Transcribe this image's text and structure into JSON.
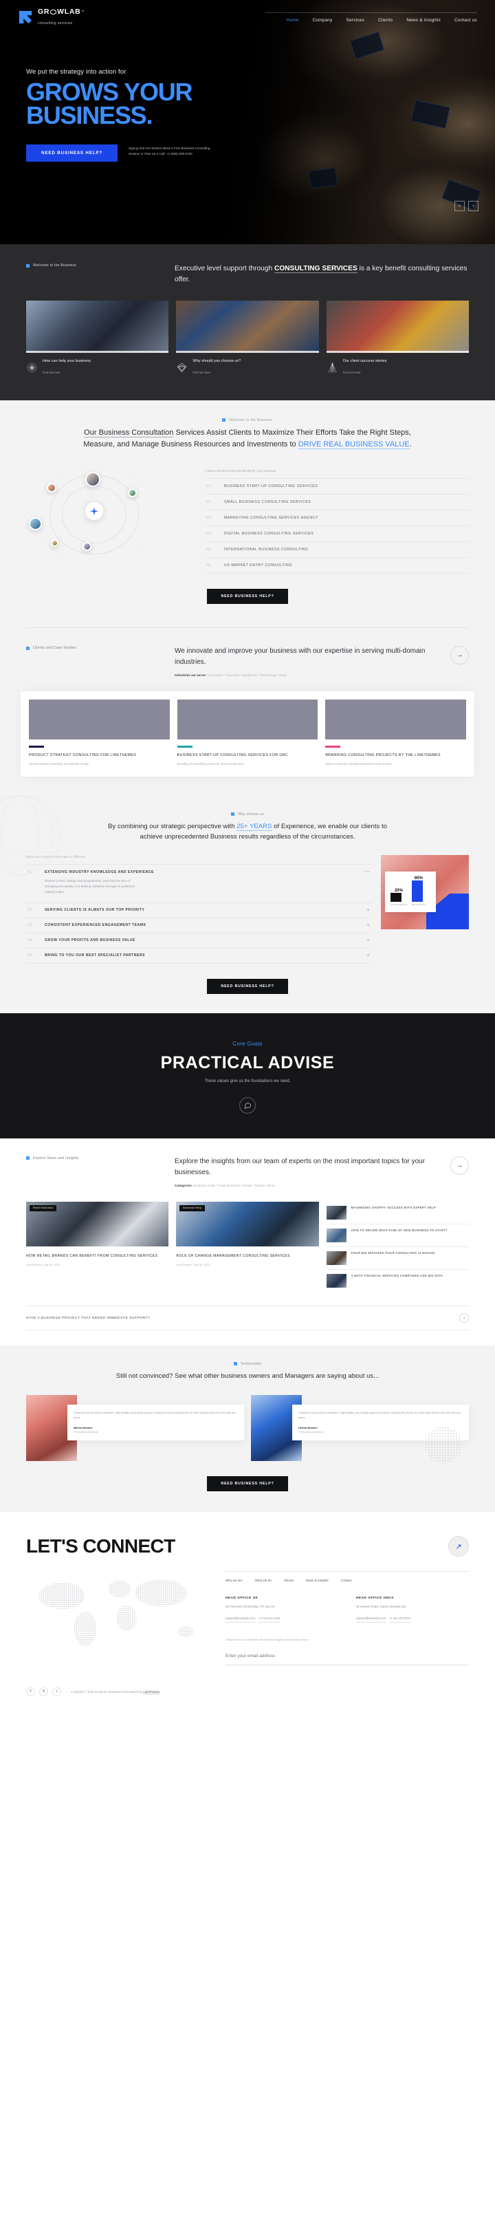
{
  "brand": {
    "name_pre": "GR",
    "name_post": "WLAB",
    "tm": "™",
    "tagline": "consulting services"
  },
  "nav": {
    "items": [
      {
        "label": "Home",
        "active": true
      },
      {
        "label": "Company",
        "active": false
      },
      {
        "label": "Services",
        "active": false
      },
      {
        "label": "Clients",
        "active": false
      },
      {
        "label": "News & Insights",
        "active": false
      },
      {
        "label": "Contact us",
        "active": false
      }
    ]
  },
  "hero": {
    "kicker": "We put the strategy into action for",
    "title_line1": "GROWS YOUR",
    "title_line2": "BUSINESS.",
    "cta": "NEED BUSINESS HELP?",
    "note": "Signup and Get Started about a Free Business Consulting Session or Give Us a Call: +1 (695) 605-0190",
    "prev": "‹",
    "next": "›"
  },
  "welcome": {
    "tag": "Welcome to the Business",
    "head_pre": "Executive level support through ",
    "head_bold": "CONSULTING SERVICES",
    "head_post": " is a key benefit consulting services offer.",
    "cards": [
      {
        "title": "How can help your business",
        "sub": "Find out more",
        "icon": "sunburst-icon"
      },
      {
        "title": "Why should you choose us?",
        "sub": "Find out more",
        "icon": "diamond-icon"
      },
      {
        "title": "Our client success stories",
        "sub": "Find out more",
        "icon": "tower-icon"
      }
    ]
  },
  "consult": {
    "tag": "Welcome to the Business",
    "head_1": "Our Business Consultation",
    "head_2": " Services Assist Clients to Maximize Their Efforts Take the Right Steps, Measure, and Manage Business Resources and Investments to ",
    "head_3": "DRIVE REAL BUSINESS VALUE",
    "head_4": ".",
    "services_lead": "Custom services built specifically for your business",
    "services": [
      {
        "n": "01.",
        "label": "BUSINESS START-UP CONSULTING SERVICES"
      },
      {
        "n": "02.",
        "label": "SMALL BUSINESS CONSULTING SERVICES"
      },
      {
        "n": "03.",
        "label": "MARKETING CONSULTING SERVICES AGENCY"
      },
      {
        "n": "04.",
        "label": "DIGITAL BUSINESS CONSULTING SERVICES"
      },
      {
        "n": "05.",
        "label": "INTERNATIONAL BUSINESS CONSULTING"
      },
      {
        "n": "06.",
        "label": "US MARKET ENTRY CONSULTING"
      }
    ],
    "cta": "NEED BUSINESS HELP?"
  },
  "clients": {
    "tag": "Clients and Case Studies",
    "head": "We innovate and improve your business with our expertise in serving multi-domain industries.",
    "meta_label": "Industries we serve:",
    "meta_items": "Consumer / Financial / Healthcare / Technology / More",
    "arrow": "→",
    "cases": [
      {
        "title": "PRODUCT STRATEGY CONSULTING FOR LINETHEMES",
        "sub": "Small business consulting and website design",
        "color": "#1b1b4b"
      },
      {
        "title": "BUSINESS START-UP CONSULTING SERVICES FOR GBC",
        "sub": "Branding & consulting project for GLB Construction",
        "color": "#1fa5ad"
      },
      {
        "title": "BRANDING CONSULTING PROJECTS BY THE LINETHEMES",
        "sub": "Start a Financial Consulting Business from scratch.",
        "color": "#e8407a"
      }
    ]
  },
  "why": {
    "tag": "Why choose us",
    "head_1": "By combining our strategic perspective with ",
    "head_blue": "25+ YEARS",
    "head_2": " of Experience, we enable our clients to achieve unprecedented Business results regardless of the circumstances.",
    "lead": "Below are 5 reasons that make us different:",
    "items": [
      {
        "n": "01.",
        "label": "EXTENSIVE INDUSTRY KNOWLEDGE AND EXPERIENCE",
        "sign": "—",
        "body": "Diverse in their settings and programmes, each had the aim of reshaping the identity of a leading institution through an ambitious capital project."
      },
      {
        "n": "02.",
        "label": "SERVING CLIENTS IS ALWAYS OUR TOP PRIORITY",
        "sign": "+",
        "body": ""
      },
      {
        "n": "03.",
        "label": "CONSISTENT EXPERIENCED ENGAGEMENT TEAMS",
        "sign": "+",
        "body": ""
      },
      {
        "n": "04.",
        "label": "GROW YOUR PROFITS AND BUSINESS VALUE",
        "sign": "+",
        "body": ""
      },
      {
        "n": "05.",
        "label": "BRING TO YOU OUR BEST SPECIALIST PARTNERS",
        "sign": "+",
        "body": ""
      }
    ],
    "cta": "NEED BUSINESS HELP?"
  },
  "chart_data": {
    "type": "bar",
    "title": "",
    "categories": [
      "without linethemes",
      "with linethemes"
    ],
    "values": [
      20,
      80
    ],
    "value_labels": [
      "20%",
      "80%"
    ],
    "colors": [
      "#111111",
      "#1b45e8"
    ],
    "ylim": [
      0,
      100
    ],
    "xlabel": "",
    "ylabel": "",
    "grid": false,
    "legend": "none"
  },
  "goals": {
    "kicker": "Core Goals",
    "heading": "PRACTICAL ADVISE",
    "sub": "These values give us the foundations we need.",
    "icon": "chat-icon",
    "icon_glyph": "💬"
  },
  "news": {
    "tag": "Explore News and Insights",
    "head": "Explore the insights from our team of experts on the most important topics for your businesses.",
    "cat_label": "Categories:",
    "cat_items": "Business Help / Small Business / Retail / Startup / More",
    "arrow": "→",
    "featured": [
      {
        "badge": "Retail Business",
        "title": "HOW RETAIL BRANDS CAN BENEFIT FROM CONSULTING SERVICES",
        "meta": "LineThemes  /  July 15, 2024"
      },
      {
        "badge": "Business Help",
        "title": "ROLE OF CHANGE MANAGEMENT CONSULTING SERVICES",
        "meta": "LineThemes  /  July 15, 2024"
      }
    ],
    "list": [
      {
        "title": "MAXIMIZING SHOPIFY SUCCESS WITH EXPERT HELP"
      },
      {
        "title": "HOW TO DECIDE WHAT KIND OF NEW BUSINESS TO START?"
      },
      {
        "title": "FOUR BIG MISTAKES FOUR CONSULTING IS MAKING"
      },
      {
        "title": "4 WAYS FINANCIAL SERVICES COMPANIES USE BIG DATA"
      }
    ],
    "project_cta": "HAVE A BUSINESS PROJECT THAT NEEDS IMMEDIATE SUPPORT?",
    "project_arrow": "→"
  },
  "testimonials": {
    "tag": "Testimonials",
    "head": "Still not convinced? See what other business owners and Managers are saying about us...",
    "items": [
      {
        "quote": "Company has provided consistent, high quality, accounting support during the exponential growth we have experienced over the past two years.",
        "name": "Marlon Western",
        "role": "VP, Business Operations"
      },
      {
        "quote": "Company has provided consistent, high quality, accounting support during the exponential growth we have experienced over the past two years.",
        "name": "Helena Western",
        "role": "VP, Business Operations"
      }
    ],
    "cta": "NEED BUSINESS HELP?"
  },
  "connect": {
    "heading": "LET'S CONNECT",
    "arrow": "↗",
    "links": [
      {
        "label": "Who we are"
      },
      {
        "label": "What we do"
      },
      {
        "label": "Clients"
      },
      {
        "label": "News & Insights"
      },
      {
        "label": "Contact"
      }
    ],
    "offices": [
      {
        "name": "HEAD OFFICE UK",
        "address": "307 Beverley Rd Brooklyn, NY 126 US",
        "email": "support@example.com",
        "phone": "+1 712 610 1420"
      },
      {
        "name": "HEAD OFFICE INDIA",
        "address": "48 Hunters Road, Vepery, Mumbai City",
        "email": "support@example.com",
        "phone": "+1 181 303 2014"
      }
    ],
    "subscribe_lead": "Subscribe to our newsletter for industry insights and company news!",
    "subscribe_placeholder": "Enter your email address",
    "socials": [
      {
        "icon": "facebook-icon",
        "glyph": "f"
      },
      {
        "icon": "x-twitter-icon",
        "glyph": "𝕏"
      },
      {
        "icon": "tiktok-icon",
        "glyph": "♪"
      }
    ],
    "copyright_pre": "Copyright © 2024 GrowLab. Designed & Developed by ",
    "copyright_brand": "LineThemes"
  }
}
